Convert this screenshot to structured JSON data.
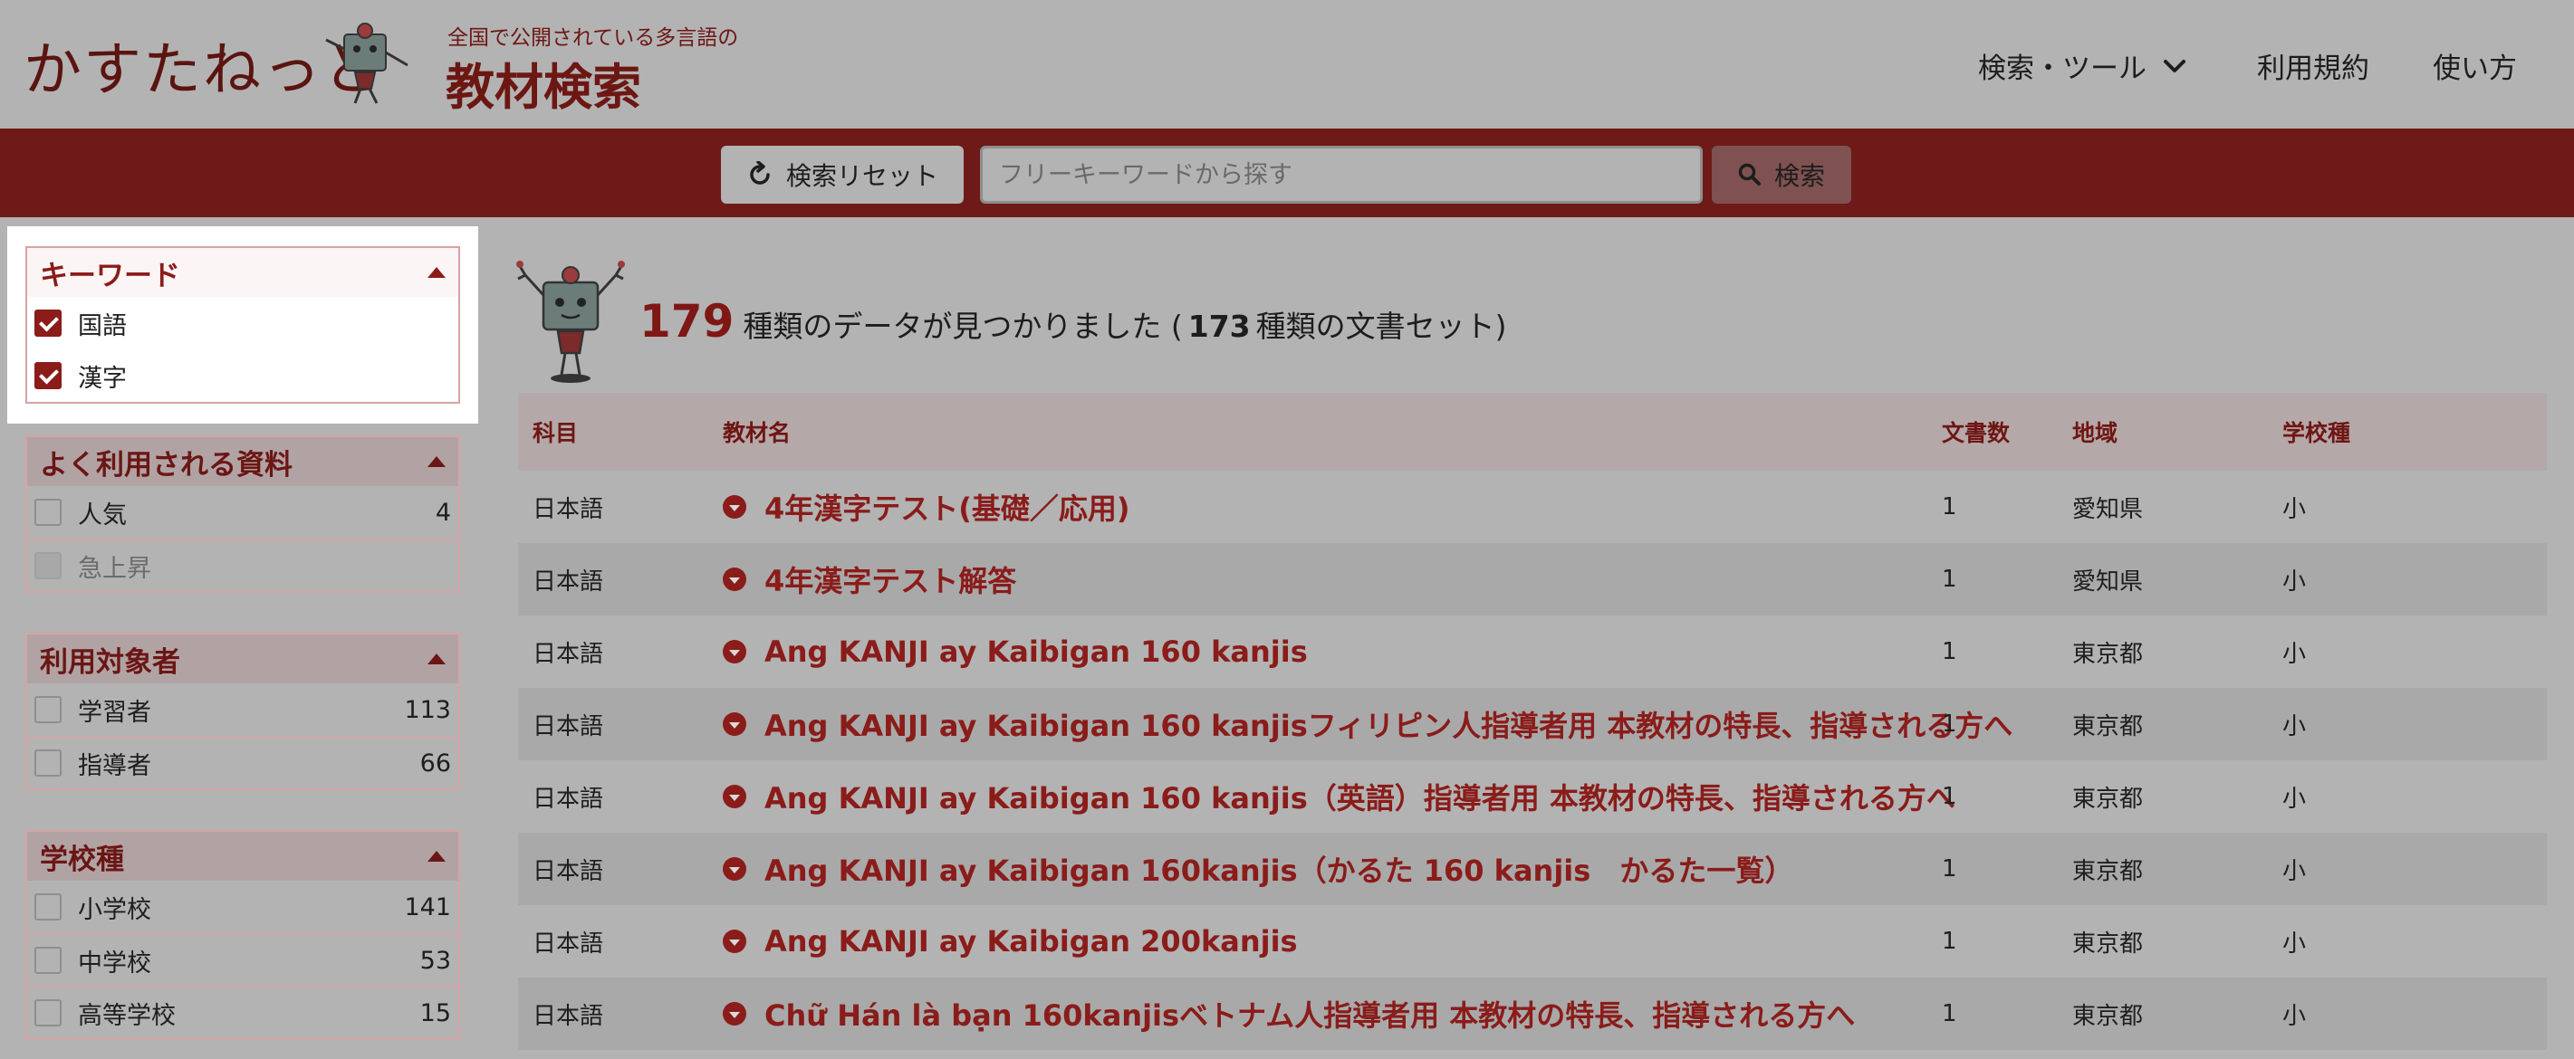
{
  "header": {
    "logo_text": "かすたねっと",
    "subtitle": "全国で公開されている多言語の",
    "title": "教材検索",
    "nav": [
      {
        "label": "検索・ツール"
      },
      {
        "label": "利用規約"
      },
      {
        "label": "使い方"
      }
    ]
  },
  "search": {
    "reset_label": "検索リセット",
    "placeholder": "フリーキーワードから探す",
    "value": "",
    "search_label": "検索"
  },
  "facets": {
    "keyword": {
      "title": "キーワード",
      "items": [
        {
          "label": "国語",
          "checked": true
        },
        {
          "label": "漢字",
          "checked": true
        }
      ]
    },
    "popular": {
      "title": "よく利用される資料",
      "items": [
        {
          "label": "人気",
          "count": "4"
        },
        {
          "label": "急上昇",
          "count": ""
        }
      ]
    },
    "audience": {
      "title": "利用対象者",
      "items": [
        {
          "label": "学習者",
          "count": "113"
        },
        {
          "label": "指導者",
          "count": "66"
        }
      ]
    },
    "school": {
      "title": "学校種",
      "items": [
        {
          "label": "小学校",
          "count": "141"
        },
        {
          "label": "中学校",
          "count": "53"
        },
        {
          "label": "高等学校",
          "count": "15"
        }
      ]
    }
  },
  "results": {
    "count": "179",
    "text_before": "種類のデータが見つかりました (",
    "sets_count": "173",
    "text_after": "種類の文書セット)"
  },
  "table": {
    "headers": {
      "subject": "科目",
      "name": "教材名",
      "docs": "文書数",
      "region": "地域",
      "school": "学校種"
    },
    "rows": [
      {
        "subject": "日本語",
        "name": "4年漢字テスト(基礎／応用)",
        "docs": "1",
        "region": "愛知県",
        "school": "小"
      },
      {
        "subject": "日本語",
        "name": "4年漢字テスト解答",
        "docs": "1",
        "region": "愛知県",
        "school": "小"
      },
      {
        "subject": "日本語",
        "name": "Ang KANJI ay Kaibigan 160 kanjis",
        "docs": "1",
        "region": "東京都",
        "school": "小"
      },
      {
        "subject": "日本語",
        "name": "Ang KANJI ay Kaibigan 160 kanjisフィリピン人指導者用 本教材の特長、指導される方へ",
        "docs": "1",
        "region": "東京都",
        "school": "小"
      },
      {
        "subject": "日本語",
        "name": "Ang KANJI ay Kaibigan 160 kanjis（英語）指導者用 本教材の特長、指導される方へ",
        "docs": "1",
        "region": "東京都",
        "school": "小"
      },
      {
        "subject": "日本語",
        "name": "Ang KANJI ay Kaibigan 160kanjis（かるた 160 kanjis　かるた一覧）",
        "docs": "1",
        "region": "東京都",
        "school": "小"
      },
      {
        "subject": "日本語",
        "name": "Ang KANJI ay Kaibigan 200kanjis",
        "docs": "1",
        "region": "東京都",
        "school": "小"
      },
      {
        "subject": "日本語",
        "name": "Chữ Hán là bạn 160kanjisベトナム人指導者用 本教材の特長、指導される方へ",
        "docs": "1",
        "region": "東京都",
        "school": "小"
      }
    ]
  },
  "icons": {
    "reset": "refresh-icon",
    "search": "search-icon",
    "dropdown": "chevron-down-icon",
    "expand": "circle-chevron-down-icon"
  },
  "colors": {
    "brand": "#8a1c1a",
    "bar": "#6e1a18"
  }
}
